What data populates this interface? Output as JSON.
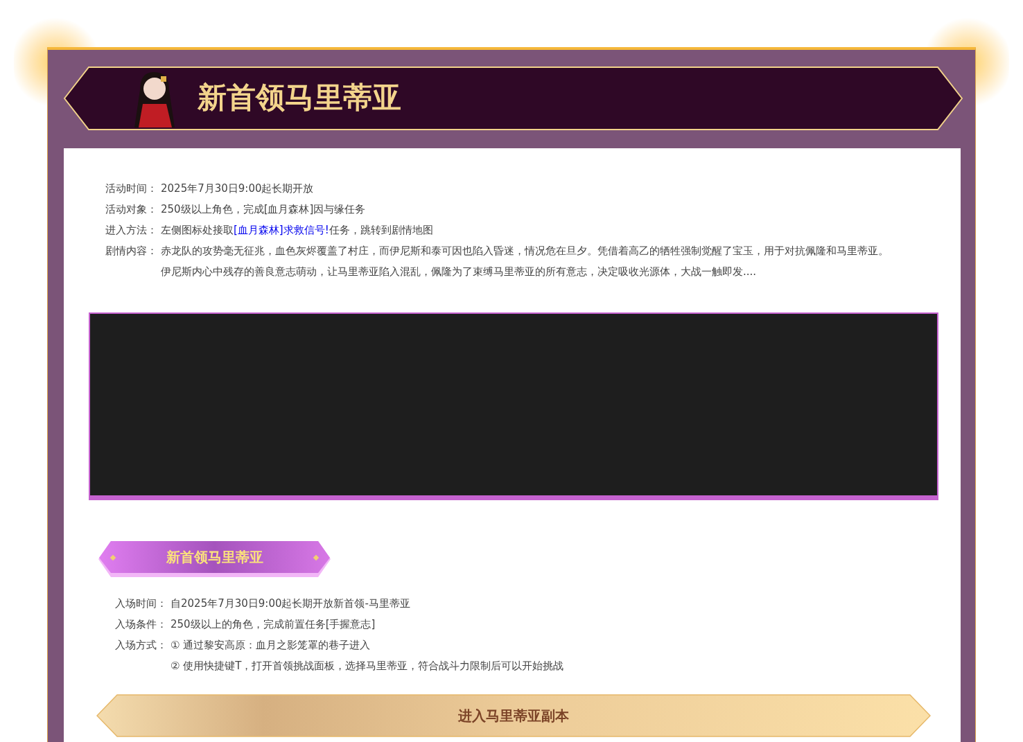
{
  "banner": {
    "title": "新首领马里蒂亚"
  },
  "info": [
    {
      "label": "活动时间：",
      "lines": [
        [
          {
            "text": "2025年7月30日9:00起长期开放",
            "link": false
          }
        ]
      ]
    },
    {
      "label": "活动对象：",
      "lines": [
        [
          {
            "text": "250级以上角色，完成[血月森林]因与缘任务",
            "link": false
          }
        ]
      ]
    },
    {
      "label": "进入方法：",
      "lines": [
        [
          {
            "text": "左侧图标处接取",
            "link": false
          },
          {
            "text": "[血月森林]求救信号!",
            "link": true
          },
          {
            "text": "任务，跳转到剧情地图",
            "link": false
          }
        ]
      ]
    },
    {
      "label": "剧情内容：",
      "lines": [
        [
          {
            "text": "赤龙队的攻势毫无征兆，血色灰烬覆盖了村庄，而伊尼斯和泰可因也陷入昏迷，情况危在旦夕。凭借着高乙的牺牲强制觉醒了宝玉，用于对抗佩隆和马里蒂亚。",
            "link": false
          }
        ],
        [
          {
            "text": "伊尼斯内心中残存的善良意志萌动，让马里蒂亚陷入混乱，佩隆为了束缚马里蒂亚的所有意志，决定吸收光源体，大战一触即发....",
            "link": false
          }
        ]
      ]
    }
  ],
  "section_title": "新首领马里蒂亚",
  "entry": [
    {
      "label": "入场时间：",
      "lines": [
        "自2025年7月30日9:00起长期开放新首领-马里蒂亚"
      ]
    },
    {
      "label": "入场条件：",
      "lines": [
        "250级以上的角色，完成前置任务[手握意志]"
      ]
    },
    {
      "label": "入场方式：",
      "lines": [
        "① 通过黎安高原：血月之影笼罩的巷子进入",
        "② 使用快捷键T，打开首领挑战面板，选择马里蒂亚，符合战斗力限制后可以开始挑战"
      ]
    }
  ],
  "enter_button": "进入马里蒂亚副本"
}
